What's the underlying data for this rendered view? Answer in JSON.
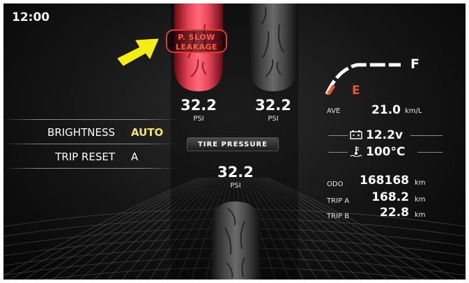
{
  "clock": "12:00",
  "warning": {
    "line1": "P. SLOW",
    "line2": "LEAKAGE"
  },
  "tires": {
    "front_left": {
      "pressure": "32.2",
      "unit": "PSI"
    },
    "front_right": {
      "pressure": "32.2",
      "unit": "PSI"
    },
    "rear": {
      "pressure": "32.2",
      "unit": "PSI"
    },
    "panel_label": "TIRE PRESSURE"
  },
  "menu": {
    "brightness_label": "BRIGHTNESS",
    "brightness_value": "AUTO",
    "trip_reset_label": "TRIP RESET",
    "trip_reset_value": "A"
  },
  "fuel": {
    "full_label": "F",
    "empty_label": "E"
  },
  "stats": {
    "ave_label": "AVE",
    "ave_value": "21.0",
    "ave_unit": "km/L",
    "voltage": "12.2v",
    "temperature": "100°C",
    "odo_label": "ODO",
    "odo_value": "168168",
    "odo_unit": "km",
    "trip_a_label": "TRIP A",
    "trip_a_value": "168.2",
    "trip_a_unit": "km",
    "trip_b_label": "TRIP B",
    "trip_b_value": "22.8",
    "trip_b_unit": "km"
  },
  "icons": {
    "warning_arrow": "arrow-icon",
    "battery": "battery-icon",
    "coolant": "coolant-temperature-icon"
  },
  "colors": {
    "warning_red": "#e23b2b",
    "highlight_yellow": "#f2e46a",
    "fuel_empty": "#e85a2a",
    "arrow_yellow": "#f5ee12"
  }
}
